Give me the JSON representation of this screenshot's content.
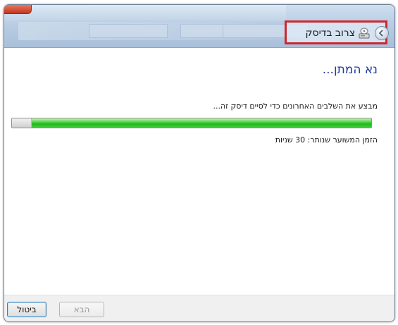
{
  "window": {
    "title": "צרוב בדיסק"
  },
  "main": {
    "heading": "נא המתן...",
    "status": "מבצע את השלבים האחרונים כדי לסיים דיסק זה...",
    "progress_fraction": 0.99,
    "time_remaining": "הזמן המשוער שנותר: 30 שניות"
  },
  "footer": {
    "next_label": "הבא",
    "cancel_label": "ביטול"
  },
  "colors": {
    "heading": "#1f3c99",
    "highlight": "#d0262c",
    "progress": "#1fb81f"
  },
  "icons": {
    "back": "back-arrow-icon",
    "disc": "disc-burner-icon"
  }
}
